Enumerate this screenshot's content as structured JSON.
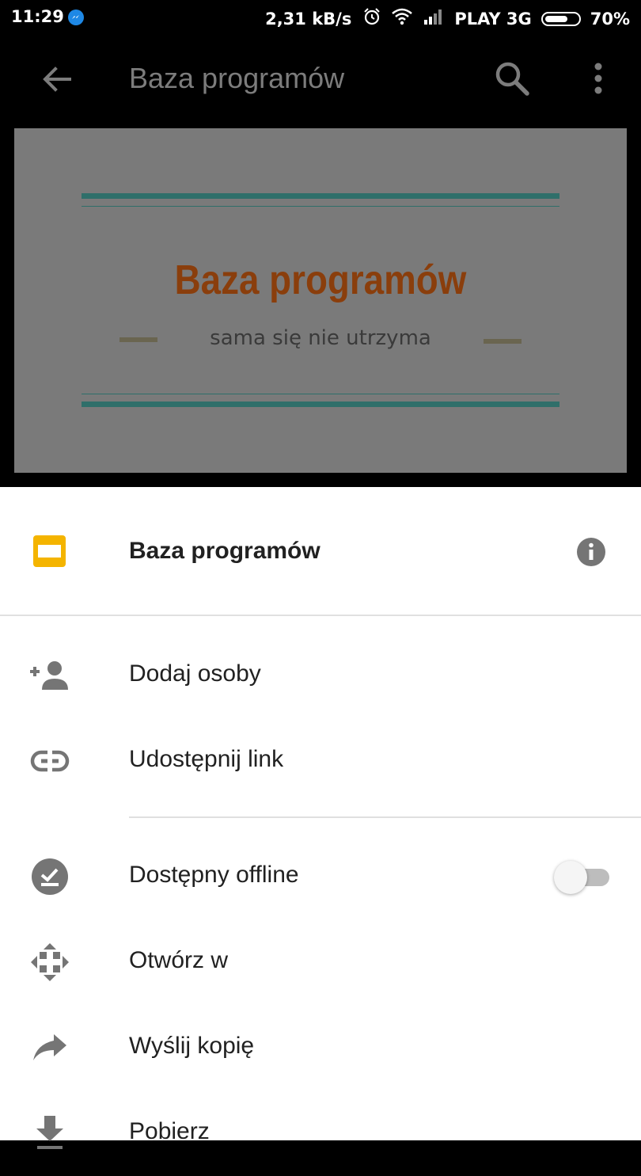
{
  "status_bar": {
    "time": "11:29",
    "net_speed": "2,31 kB/s",
    "carrier": "PLAY 3G",
    "battery_text": "70%",
    "battery_level": 0.7,
    "icons": [
      "messenger-icon",
      "alarm-icon",
      "wifi-icon",
      "signal-icon",
      "battery-icon"
    ]
  },
  "app_bar": {
    "title": "Baza programów",
    "icons": [
      "back-arrow-icon",
      "search-icon",
      "more-vert-icon"
    ]
  },
  "slide_preview": {
    "title": "Baza programów",
    "subtitle": "sama się nie utrzyma"
  },
  "sheet": {
    "file_title": "Baza programów",
    "file_icon": "slides-file-icon",
    "info_icon": "info-icon",
    "items": [
      {
        "label": "Dodaj osoby",
        "icon": "add-person-icon"
      },
      {
        "label": "Udostępnij link",
        "icon": "link-icon"
      },
      {
        "label": "Dostępny offline",
        "icon": "offline-icon",
        "toggle": false
      },
      {
        "label": "Otwórz w",
        "icon": "open-with-icon"
      },
      {
        "label": "Wyślij kopię",
        "icon": "share-forward-icon"
      },
      {
        "label": "Pobierz",
        "icon": "download-icon"
      }
    ]
  },
  "colors": {
    "slides_yellow": "#f4b400",
    "slide_title": "#8a3e0c",
    "slide_rule": "#2f6f6a",
    "icon_gray": "#757575"
  }
}
